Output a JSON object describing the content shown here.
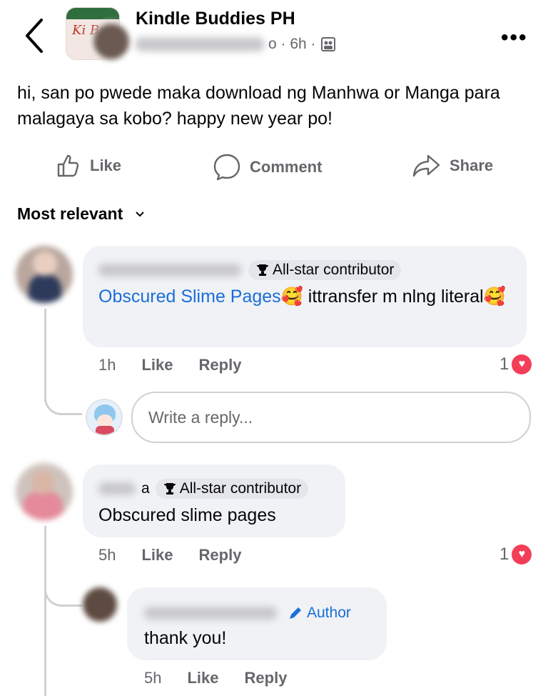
{
  "header": {
    "group_name": "Kindle Buddies PH",
    "meta_suffix": "o · 6h ·",
    "group_avatar_text": "Ki Bu",
    "more_label": "•••"
  },
  "post": {
    "text": "hi, san po pwede maka download ng Manhwa or Manga para malagaya sa kobo? happy new year po!"
  },
  "actions": {
    "like": "Like",
    "comment": "Comment",
    "share": "Share"
  },
  "sort": {
    "label": "Most relevant"
  },
  "comments": [
    {
      "badge": "All-star contributor",
      "link_text": "Obscured Slime Pages",
      "emoji_1": "🥰",
      "text_after": " ittransfer m nlng literal",
      "emoji_2": "🥰",
      "time": "1h",
      "like": "Like",
      "reply": "Reply",
      "reactions": "1"
    },
    {
      "name_fragment": "a",
      "badge": "All-star contributor",
      "text": "Obscured slime pages",
      "time": "5h",
      "like": "Like",
      "reply": "Reply",
      "reactions": "1"
    }
  ],
  "reply_input": {
    "placeholder": "Write a reply..."
  },
  "nested_reply": {
    "author_label": "Author",
    "text": "thank you!",
    "time": "5h",
    "like": "Like",
    "reply": "Reply"
  },
  "colors": {
    "link": "#1a6ed8",
    "heart": "#f33e58",
    "bubble": "#f0f2f5"
  }
}
